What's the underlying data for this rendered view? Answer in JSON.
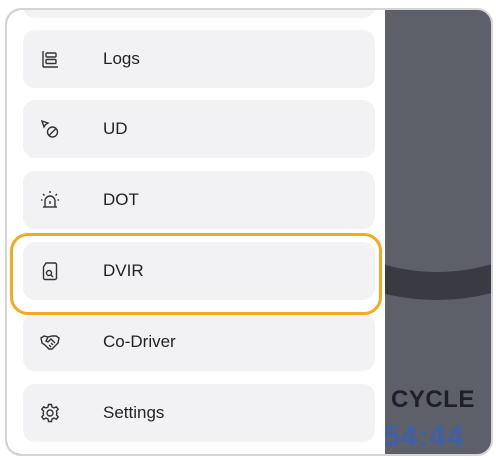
{
  "menu": {
    "items": [
      {
        "label": "Logs",
        "icon": "logs-icon"
      },
      {
        "label": "UD",
        "icon": "ud-icon"
      },
      {
        "label": "DOT",
        "icon": "dot-alarm-icon"
      },
      {
        "label": "DVIR",
        "icon": "dvir-icon"
      },
      {
        "label": "Co-Driver",
        "icon": "handshake-icon"
      },
      {
        "label": "Settings",
        "icon": "gear-icon"
      }
    ],
    "highlighted": "DVIR"
  },
  "background": {
    "cycle_label": "CYCLE",
    "cycle_time": "54:44"
  },
  "colors": {
    "highlight_border": "#f2aa1f",
    "menu_item_bg": "#f2f2f4",
    "overlay_bg": "#5d5f69",
    "cycle_time_color": "#3f5fa8"
  }
}
